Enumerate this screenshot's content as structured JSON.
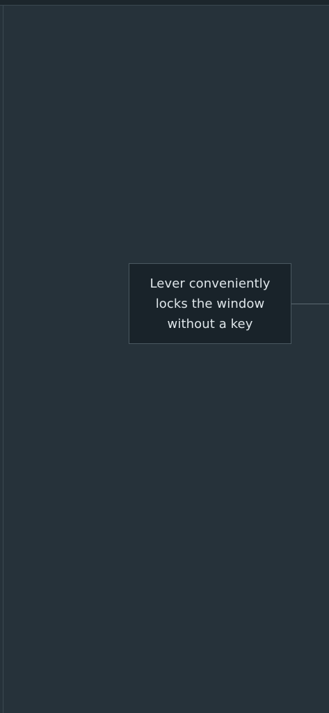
{
  "callout": {
    "text": "Lever conveniently locks the window without a key"
  }
}
